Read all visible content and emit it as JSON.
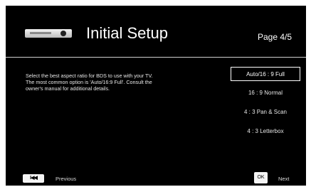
{
  "header": {
    "title": "Initial Setup",
    "page": "Page 4/5",
    "icon": "disc-player-icon"
  },
  "instructions": [
    "Select the best aspect ratio for BDS to use with your TV.",
    "The most common option is 'Auto/16:9 Full'. Consult the",
    "owner's manual for additional details."
  ],
  "options": [
    {
      "label": "Auto/16 : 9 Full",
      "selected": true
    },
    {
      "label": "16 : 9 Normal",
      "selected": false
    },
    {
      "label": "4 : 3 Pan & Scan",
      "selected": false
    },
    {
      "label": "4 : 3 Letterbox",
      "selected": false
    }
  ],
  "footer": {
    "prev_key": "I◀◀",
    "prev_label": "Previous",
    "ok_key": "OK",
    "next_label": "Next"
  },
  "colors": {
    "background": "#000000",
    "text": "#ffffff"
  }
}
